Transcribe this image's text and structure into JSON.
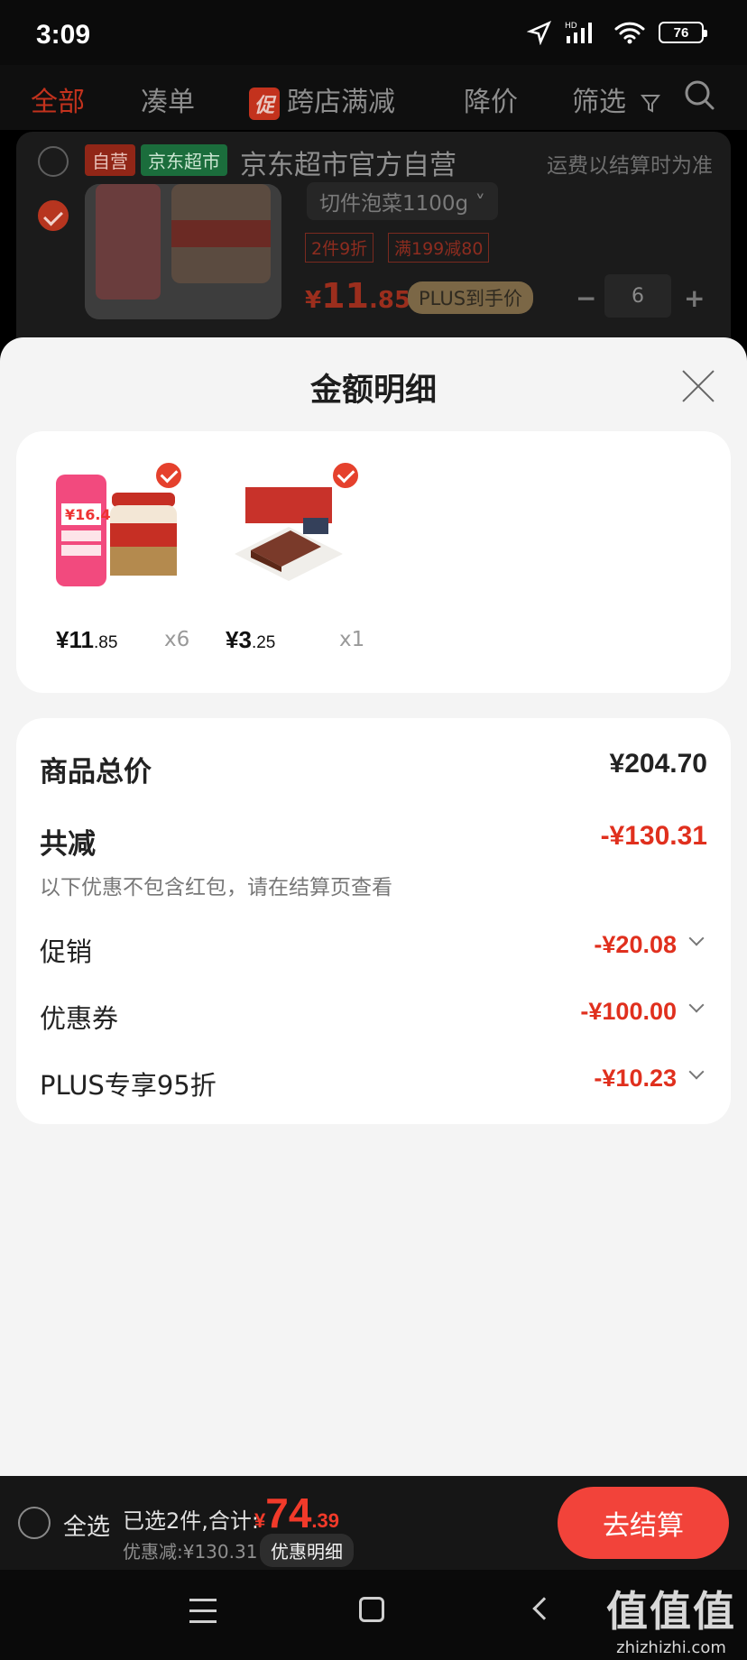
{
  "status_bar": {
    "time": "3:09",
    "battery": "76",
    "network": "HD"
  },
  "tabs": [
    {
      "label": "全部",
      "active": true
    },
    {
      "label": "凑单"
    },
    {
      "label": "跨店满减",
      "mark": "促"
    },
    {
      "label": "降价"
    },
    {
      "label": "筛选"
    }
  ],
  "store": {
    "tag_self": "自营",
    "tag_jd": "京东超市",
    "name": "京东超市官方自营",
    "shipping_note": "运费以结算时为准",
    "product": {
      "spec": "切件泡菜1100g",
      "badges": [
        "2件9折",
        "满199减80"
      ],
      "price_currency": "¥",
      "price_int": "11",
      "price_dec": ".85",
      "plus_label": "PLUS到手价",
      "quantity": "6"
    }
  },
  "sheet": {
    "title": "金额明细",
    "items": [
      {
        "currency": "¥",
        "int": "11",
        "dec": ".85",
        "qty": "x6",
        "image": "kimchi-jar"
      },
      {
        "currency": "¥",
        "int": "3",
        "dec": ".25",
        "qty": "x1",
        "image": "braised-meat-pack"
      }
    ],
    "summary": {
      "total_label": "商品总价",
      "total_value": "¥204.70",
      "reduce_label": "共减",
      "reduce_value": "-¥130.31",
      "reduce_note": "以下优惠不包含红包，请在结算页查看",
      "lines": [
        {
          "label": "促销",
          "value": "-¥20.08"
        },
        {
          "label": "优惠券",
          "value": "-¥100.00"
        },
        {
          "label": "PLUS专享95折",
          "value": "-¥10.23"
        }
      ]
    }
  },
  "bottom_bar": {
    "select_all": "全选",
    "selected_info": "已选2件,合计:",
    "total_currency": "¥",
    "total_int": "74",
    "total_dec": ".39",
    "discount_text": "优惠减:¥130.31",
    "detail_label": "优惠明细",
    "checkout_label": "去结算"
  },
  "watermark": {
    "logo": "值值值",
    "site": "zhizhizhi.com"
  },
  "colors": {
    "accent_red": "#e0301e",
    "checkout_red": "#f2433a",
    "sheet_bg": "#f4f4f4"
  }
}
